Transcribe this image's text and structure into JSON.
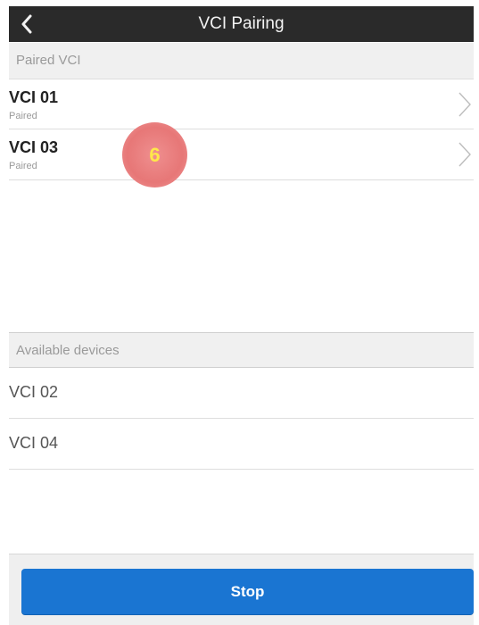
{
  "header": {
    "title": "VCI Pairing",
    "back_icon": "chevron-left-icon"
  },
  "paired": {
    "section_title": "Paired VCI",
    "items": [
      {
        "name": "VCI 01",
        "status": "Paired"
      },
      {
        "name": "VCI 03",
        "status": "Paired"
      }
    ]
  },
  "overlay": {
    "label": "6"
  },
  "available": {
    "section_title": "Available devices",
    "items": [
      {
        "name": "VCI 02"
      },
      {
        "name": "VCI 04"
      }
    ]
  },
  "footer": {
    "stop_label": "Stop"
  },
  "colors": {
    "topbar": "#2a2a2a",
    "primary_button": "#1a75d2",
    "section_bg": "#f0f0f0",
    "overlay_badge": "#e77777",
    "overlay_text": "#ffe84a"
  }
}
